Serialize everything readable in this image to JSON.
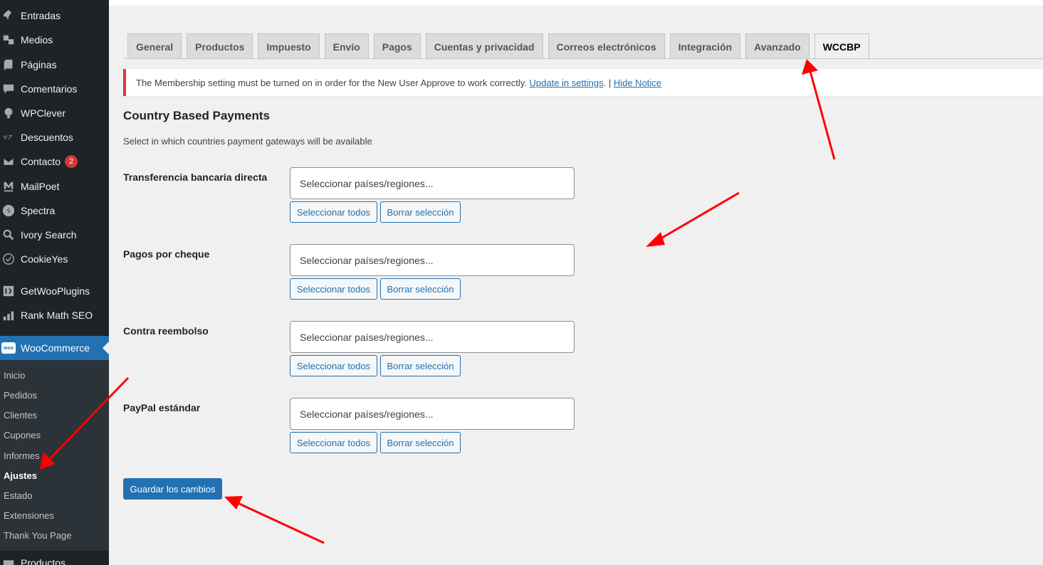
{
  "sidebar": {
    "items": [
      {
        "label": "Entradas",
        "icon": "pin-icon"
      },
      {
        "label": "Medios",
        "icon": "media-icon"
      },
      {
        "label": "Páginas",
        "icon": "pages-icon"
      },
      {
        "label": "Comentarios",
        "icon": "comments-icon"
      },
      {
        "label": "WPClever",
        "icon": "wpclever-icon"
      },
      {
        "label": "Descuentos",
        "icon": "discounts-icon"
      },
      {
        "label": "Contacto",
        "icon": "mail-icon",
        "badge": "2"
      },
      {
        "label": "MailPoet",
        "icon": "mailpoet-icon"
      },
      {
        "label": "Spectra",
        "icon": "spectra-icon"
      },
      {
        "label": "Ivory Search",
        "icon": "search-icon"
      },
      {
        "label": "CookieYes",
        "icon": "cookie-icon"
      },
      {
        "label": "GetWooPlugins",
        "icon": "plugins-icon"
      },
      {
        "label": "Rank Math SEO",
        "icon": "chart-icon"
      }
    ],
    "active": {
      "label": "WooCommerce",
      "icon_text": "woo"
    },
    "submenu": [
      "Inicio",
      "Pedidos",
      "Clientes",
      "Cupones",
      "Informes",
      "Ajustes",
      "Estado",
      "Extensiones",
      "Thank You Page"
    ],
    "current_submenu": "Ajustes",
    "next_item": "Productos"
  },
  "tabs": [
    "General",
    "Productos",
    "Impuesto",
    "Envío",
    "Pagos",
    "Cuentas y privacidad",
    "Correos electrónicos",
    "Integración",
    "Avanzado",
    "WCCBP"
  ],
  "active_tab": "WCCBP",
  "notice": {
    "text": "The Membership setting must be turned on in order for the New User Approve to work correctly.",
    "link1": "Update in settings",
    "separator": ". |",
    "link2": "Hide Notice"
  },
  "page": {
    "title": "Country Based Payments",
    "description": "Select in which countries payment gateways will be available"
  },
  "gateways": [
    {
      "label": "Transferencia bancaria directa"
    },
    {
      "label": "Pagos por cheque"
    },
    {
      "label": "Contra reembolso"
    },
    {
      "label": "PayPal estándar"
    }
  ],
  "select_placeholder": "Seleccionar países/regiones...",
  "select_all_label": "Seleccionar todos",
  "clear_label": "Borrar selección",
  "save_label": "Guardar los cambios",
  "colors": {
    "sidebar_bg": "#1d2327",
    "accent": "#2271b1",
    "notice_error": "#d63638",
    "arrow": "#ff0000"
  }
}
